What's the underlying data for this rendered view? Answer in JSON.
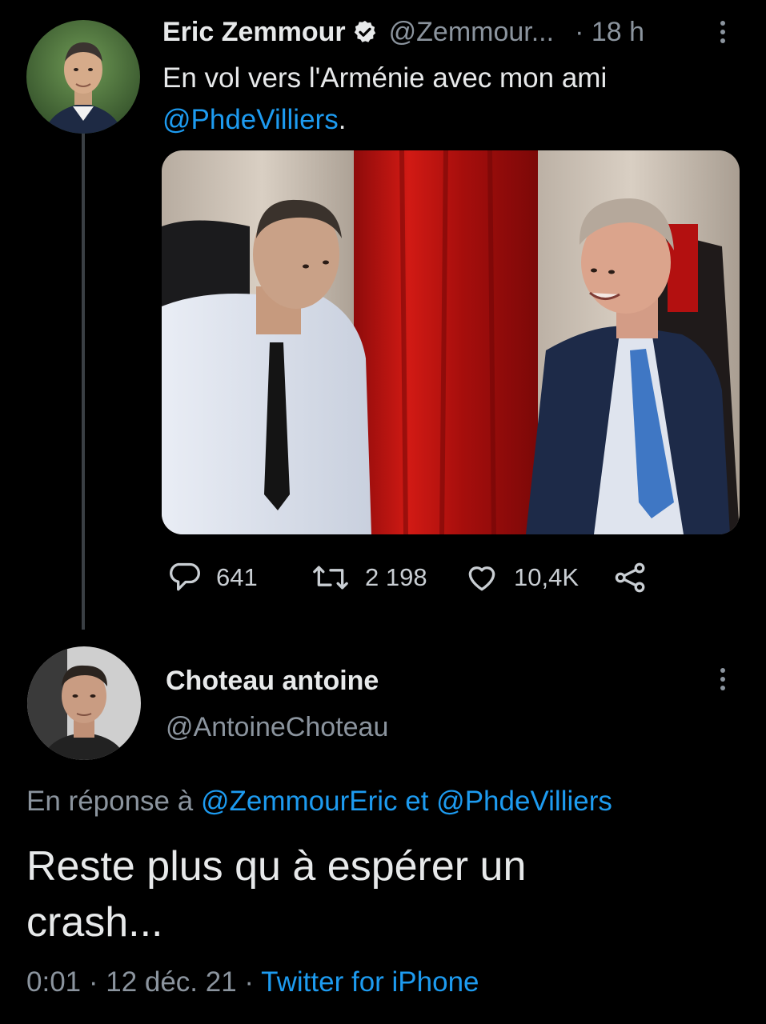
{
  "tweet": {
    "author_name": "Eric Zemmour",
    "author_handle": "@Zemmour...",
    "time": "· 18 h",
    "text": "En vol vers l'Arménie avec mon ami",
    "mention": "@PhdeVilliers",
    "mention_suffix": ".",
    "stats": {
      "replies": "641",
      "retweets": "2 198",
      "likes": "10,4K"
    },
    "icons": {
      "verified": "verified-badge-icon",
      "reply": "reply-icon",
      "retweet": "retweet-icon",
      "like": "heart-icon",
      "share": "share-icon",
      "more": "more-options-icon"
    }
  },
  "reply": {
    "author_name": "Choteau antoine",
    "author_handle": "@AntoineChoteau",
    "reply_to_prefix": "En réponse à",
    "reply_to_user1": "@ZemmourEric",
    "reply_to_and": "et",
    "reply_to_user2": "@PhdeVilliers",
    "text_line1": "Reste plus qu à espérer un",
    "text_line2": "crash...",
    "timestamp": "0:01 · 12 déc. 21 ·",
    "source": "Twitter for iPhone"
  },
  "colors": {
    "background": "#000000",
    "text": "#e7e9ea",
    "muted": "#8b949e",
    "link": "#1d9bf0"
  }
}
